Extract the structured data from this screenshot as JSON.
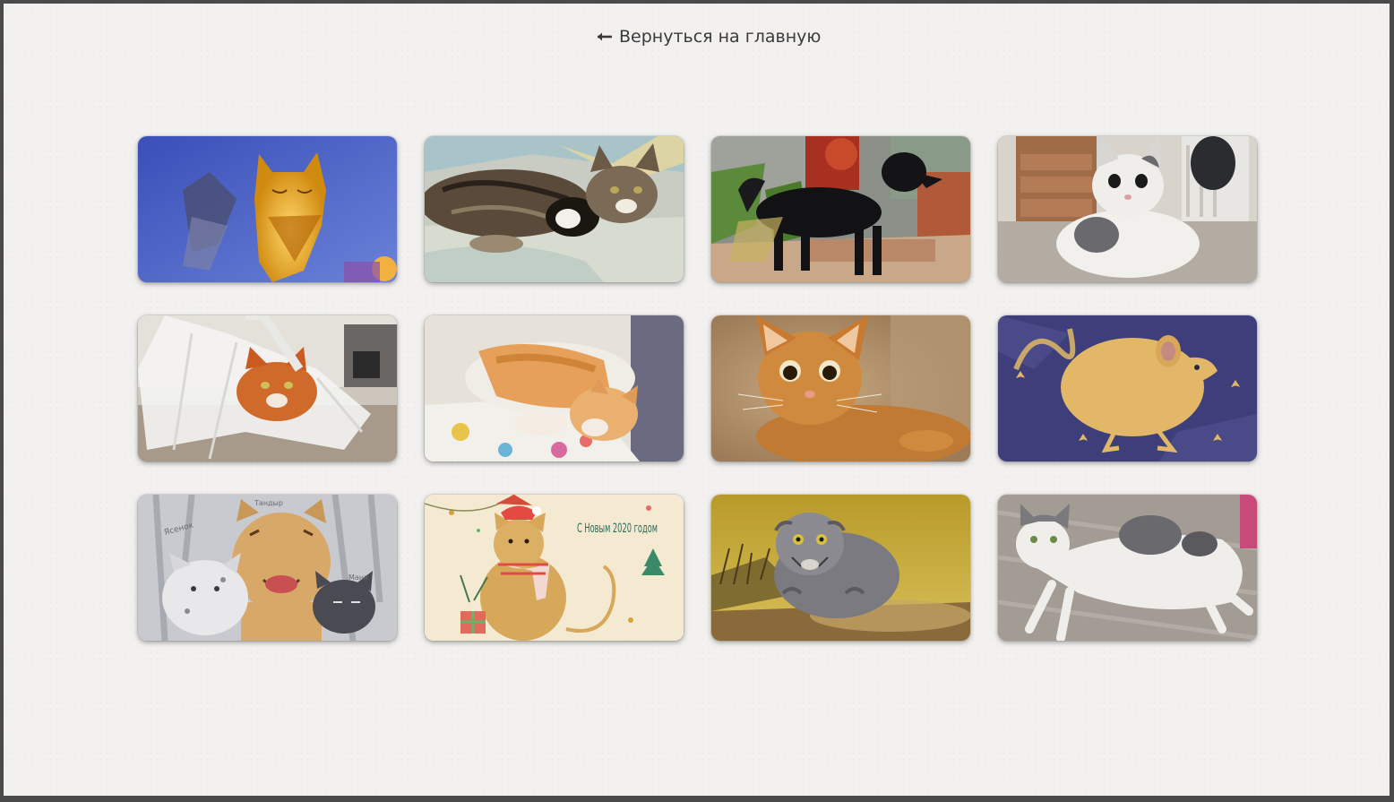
{
  "nav": {
    "back_label": "Вернуться на главную",
    "back_icon": "arrow-left-icon"
  },
  "gallery": {
    "items": [
      {
        "name": "gallery-item-golden-cat-lamp",
        "subject": "golden-cat-lamp"
      },
      {
        "name": "gallery-item-tabby-cats-sleeping",
        "subject": "tabby-cats-sleeping"
      },
      {
        "name": "gallery-item-black-dog",
        "subject": "black-dog"
      },
      {
        "name": "gallery-item-white-gray-cat",
        "subject": "white-gray-cat"
      },
      {
        "name": "gallery-item-ginger-cat-bag",
        "subject": "ginger-cat-bag"
      },
      {
        "name": "gallery-item-ginger-cat-sleeping",
        "subject": "ginger-cat-sleeping"
      },
      {
        "name": "gallery-item-ginger-kitten",
        "subject": "ginger-kitten"
      },
      {
        "name": "gallery-item-rat-drawing",
        "subject": "rat-drawing"
      },
      {
        "name": "gallery-item-big-cats-drawing",
        "subject": "big-cats-drawing",
        "labels": [
          "Ясенок",
          "Тандыр",
          "Маня"
        ]
      },
      {
        "name": "gallery-item-new-year-rat-card",
        "subject": "new-year-rat-card",
        "text": "С Новым 2020 годом"
      },
      {
        "name": "gallery-item-pallas-cat",
        "subject": "pallas-cat"
      },
      {
        "name": "gallery-item-white-cat-lying",
        "subject": "white-cat-lying"
      }
    ]
  }
}
